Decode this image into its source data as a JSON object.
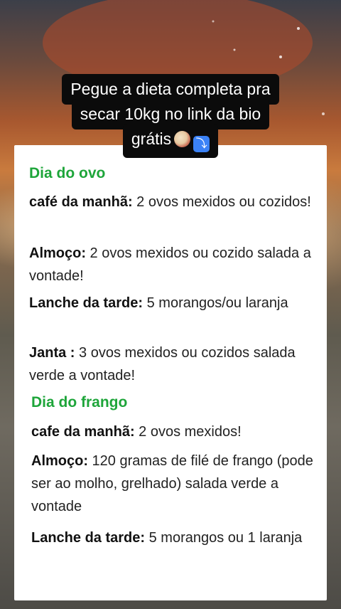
{
  "caption": {
    "line1": "Pegue a dieta completa pra",
    "line2": "secar 10kg no link da bio",
    "line3": "grátis",
    "emojis": [
      "salad-emoji",
      "down-arrow-emoji"
    ]
  },
  "diet": {
    "sections": [
      {
        "title": "Dia do ovo",
        "items": [
          {
            "label": "café da manhã:",
            "text": " 2 ovos mexidos ou cozidos!"
          },
          {
            "label": "Almoço:",
            "text": " 2 ovos mexidos ou cozido salada a vontade!"
          },
          {
            "label": "Lanche da tarde:",
            "text": " 5 morangos/ou laranja"
          },
          {
            "label": "Janta :",
            "text": " 3 ovos mexidos ou cozidos salada verde a vontade!"
          }
        ]
      },
      {
        "title": "Dia do frango",
        "items": [
          {
            "label": "cafe da manhã:",
            "text": " 2 ovos mexidos!"
          },
          {
            "label": "Almoço:",
            "text": " 120 gramas de filé de frango (pode ser ao molho, grelhado) salada verde a vontade"
          },
          {
            "label": "Lanche da tarde:",
            "text": " 5 morangos ou 1 laranja"
          }
        ]
      }
    ]
  },
  "colors": {
    "section_title": "#1ea53a",
    "card": "#ffffff",
    "caption_bg": "#0b0b0b"
  }
}
